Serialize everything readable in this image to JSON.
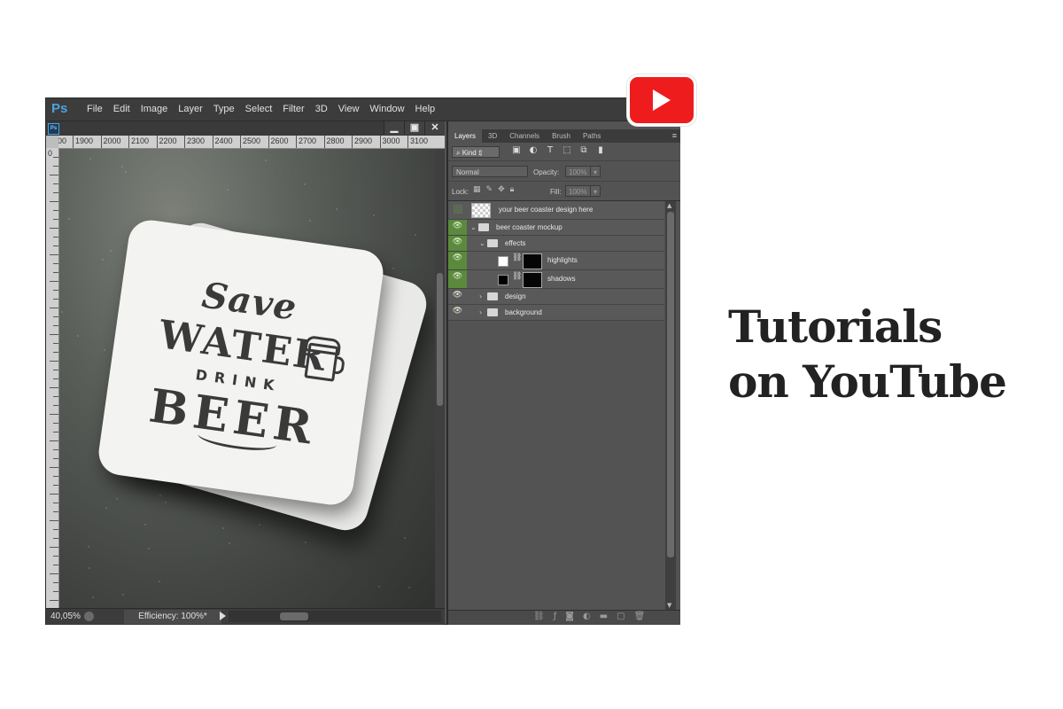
{
  "app": {
    "logo": "Ps",
    "menu": [
      "File",
      "Edit",
      "Image",
      "Layer",
      "Type",
      "Select",
      "Filter",
      "3D",
      "View",
      "Window",
      "Help"
    ]
  },
  "document": {
    "icon_label": "Ps",
    "window_controls": [
      "minimize",
      "maximize",
      "close"
    ],
    "ruler_top": [
      "00",
      "1900",
      "2000",
      "2100",
      "2200",
      "2300",
      "2400",
      "2500",
      "2600",
      "2700",
      "2800",
      "2900",
      "3000",
      "3100"
    ],
    "ruler_left_zero": "0",
    "artwork": {
      "line1": "Save",
      "line2": "WATER",
      "line3": "DRINK",
      "line4": "BEER"
    },
    "status": {
      "zoom": "40,05%",
      "efficiency": "Efficiency: 100%*"
    }
  },
  "layers_panel": {
    "tabs": [
      "Layers",
      "3D",
      "Channels",
      "Brush",
      "Paths"
    ],
    "active_tab": "Layers",
    "kind_filter": "Kind",
    "blend_mode": "Normal",
    "opacity_label": "Opacity:",
    "opacity_value": "100%",
    "lock_label": "Lock:",
    "fill_label": "Fill:",
    "fill_value": "100%",
    "layers": [
      {
        "name": "your beer coaster design here",
        "visible": false,
        "type": "smart-object"
      },
      {
        "name": "beer coaster mockup",
        "visible": true,
        "type": "group-open"
      },
      {
        "name": "effects",
        "visible": true,
        "type": "group-open"
      },
      {
        "name": "highlights",
        "visible": true,
        "type": "masked"
      },
      {
        "name": "shadows",
        "visible": true,
        "type": "masked"
      },
      {
        "name": "design",
        "visible": true,
        "type": "group-closed"
      },
      {
        "name": "background",
        "visible": true,
        "type": "group-closed"
      }
    ]
  },
  "heading": {
    "line1": "Tutorials",
    "line2": "on YouTube"
  },
  "colors": {
    "youtube_red": "#ee1c1c",
    "visibility_green": "#5b8a3c",
    "ps_blue": "#4aa3df",
    "heading_text": "#222222"
  }
}
